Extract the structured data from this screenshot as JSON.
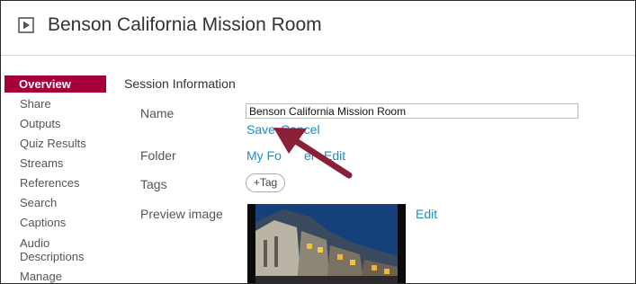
{
  "header": {
    "title": "Benson California Mission Room",
    "icon": "play-icon"
  },
  "sidebar": {
    "items": [
      {
        "label": "Overview",
        "active": true
      },
      {
        "label": "Share"
      },
      {
        "label": "Outputs"
      },
      {
        "label": "Quiz Results"
      },
      {
        "label": "Streams"
      },
      {
        "label": "References"
      },
      {
        "label": "Search"
      },
      {
        "label": "Captions"
      },
      {
        "label": "Audio"
      },
      {
        "label": "Descriptions"
      },
      {
        "label": "Manage"
      }
    ]
  },
  "main": {
    "section_title": "Session Information",
    "name": {
      "label": "Name",
      "value": "Benson California Mission Room",
      "save": "Save",
      "cancel": "Cancel"
    },
    "folder": {
      "label": "Folder",
      "value": "My Fo",
      "value_tail": "er",
      "edit": "Edit"
    },
    "tags": {
      "label": "Tags",
      "add": "+Tag"
    },
    "preview": {
      "label": "Preview image",
      "edit": "Edit"
    }
  },
  "colors": {
    "accent": "#a5003c",
    "link": "#1e8cc9",
    "arrow": "#8a2038"
  }
}
